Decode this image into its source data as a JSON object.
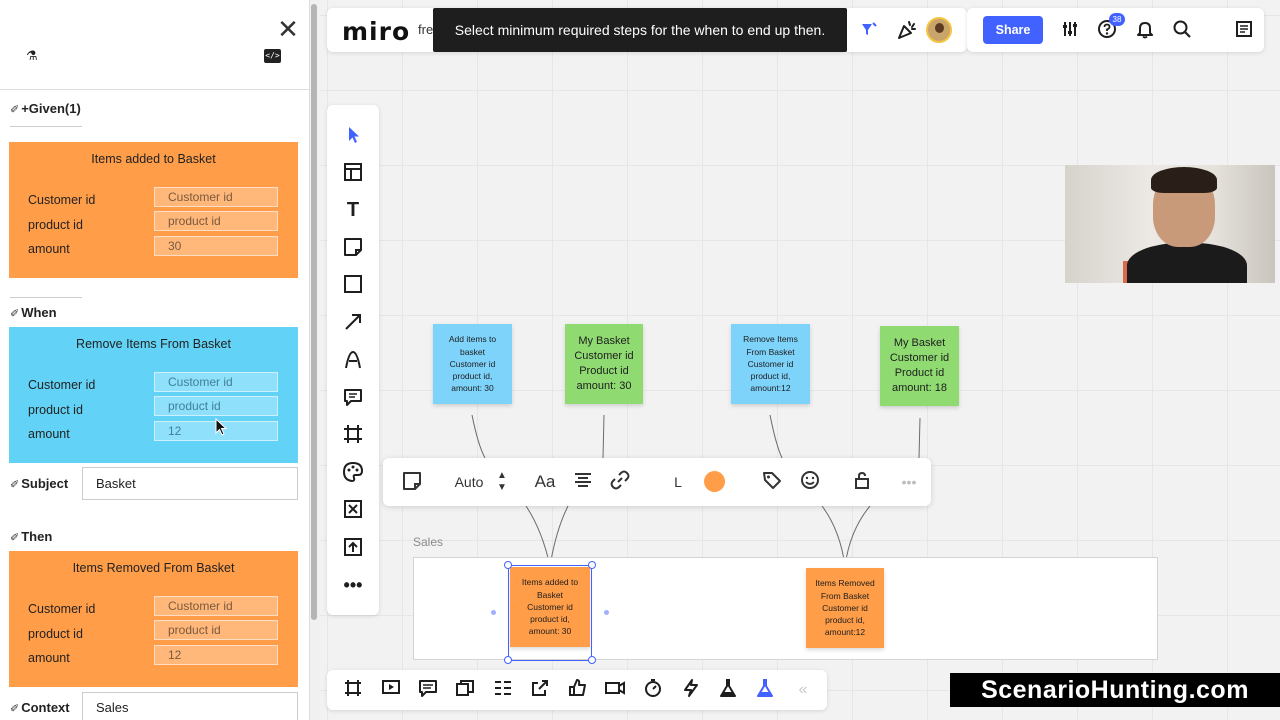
{
  "panel": {
    "given": {
      "label": "+Given(1)",
      "card": {
        "title": "Items added to Basket",
        "fields": [
          {
            "label": "Customer id",
            "value": "Customer id"
          },
          {
            "label": "product id",
            "value": "product id"
          },
          {
            "label": "amount",
            "value": "30"
          }
        ]
      }
    },
    "when": {
      "label": "When",
      "card": {
        "title": "Remove Items From Basket",
        "fields": [
          {
            "label": "Customer id",
            "value": "Customer id"
          },
          {
            "label": "product id",
            "value": "product id"
          },
          {
            "label": "amount",
            "value": "12"
          }
        ]
      }
    },
    "subject": {
      "label": "Subject",
      "value": "Basket"
    },
    "then": {
      "label": "Then",
      "card": {
        "title": "Items Removed From Basket",
        "fields": [
          {
            "label": "Customer id",
            "value": "Customer id"
          },
          {
            "label": "product id",
            "value": "product id"
          },
          {
            "label": "amount",
            "value": "12"
          }
        ]
      }
    },
    "context": {
      "label": "Context",
      "value": "Sales"
    }
  },
  "topbar": {
    "logo": "miro",
    "board_name": "fre",
    "toast": "Select minimum required steps for the when to end up then.",
    "share_label": "Share",
    "help_badge": "38"
  },
  "context_toolbar": {
    "auto_label": "Auto",
    "font_label": "Aa",
    "size_label": "L",
    "color": "#ff9d48"
  },
  "stickies": [
    {
      "text": "Add items to\nbasket\nCustomer id\nproduct id,\namount: 30",
      "color": "blue"
    },
    {
      "text": "My Basket\nCustomer id\nProduct id\namount: 30",
      "color": "green"
    },
    {
      "text": "Remove Items\nFrom Basket\nCustomer id\nproduct id,\namount:12",
      "color": "blue"
    },
    {
      "text": "My Basket\nCustomer id\nProduct id\namount: 18",
      "color": "green"
    },
    {
      "text": "Items added to\nBasket\nCustomer id\nproduct id,\namount: 30",
      "color": "orange"
    },
    {
      "text": "Items Removed\nFrom Basket\nCustomer id\nproduct id,\namount:12",
      "color": "orange"
    }
  ],
  "frame": {
    "label": "Sales"
  },
  "watermark": "ScenarioHunting.com"
}
